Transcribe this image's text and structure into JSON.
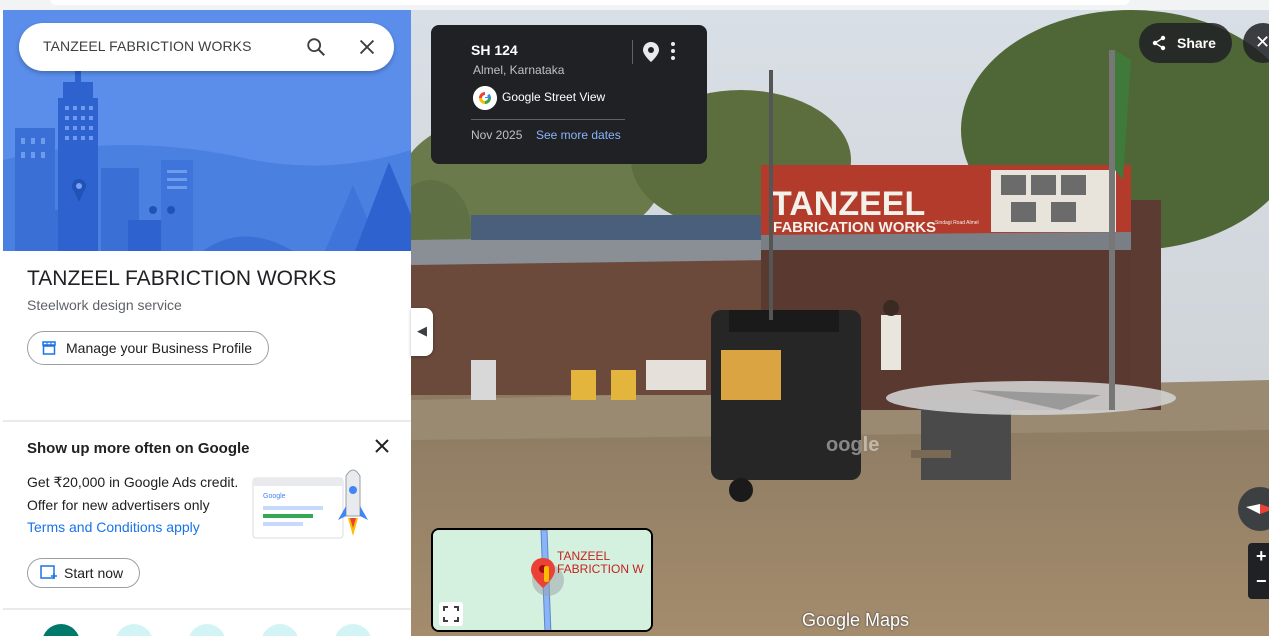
{
  "search": {
    "query": "TANZEEL FABRICTION WORKS"
  },
  "place": {
    "name": "TANZEEL FABRICTION WORKS",
    "category": "Steelwork design service",
    "manage_label": "Manage your Business Profile"
  },
  "promo": {
    "title": "Show up more often on Google",
    "line1": "Get ₹20,000 in Google Ads credit.",
    "line2": "Offer for new advertisers only",
    "link": "Terms and Conditions apply",
    "illustration_text": "Google",
    "start_label": "Start now"
  },
  "streetview": {
    "road": "SH 124",
    "location": "Almel, Karnataka",
    "brand": "Google Street View",
    "date": "Nov 2025",
    "see_more": "See more dates",
    "share_label": "Share",
    "minimap_label": "TANZEEL\nFABRICTION W",
    "watermark": "Google Maps",
    "imagery_watermark": "oogle",
    "signboard": {
      "line1": "TANZEEL",
      "line2": "FABRICATION WORKS",
      "tag": "Sindagi Road Almel"
    }
  },
  "colors": {
    "hero": "#4f87e8",
    "link": "#1a73e8",
    "card": "#202124",
    "accent": "#00796b"
  }
}
